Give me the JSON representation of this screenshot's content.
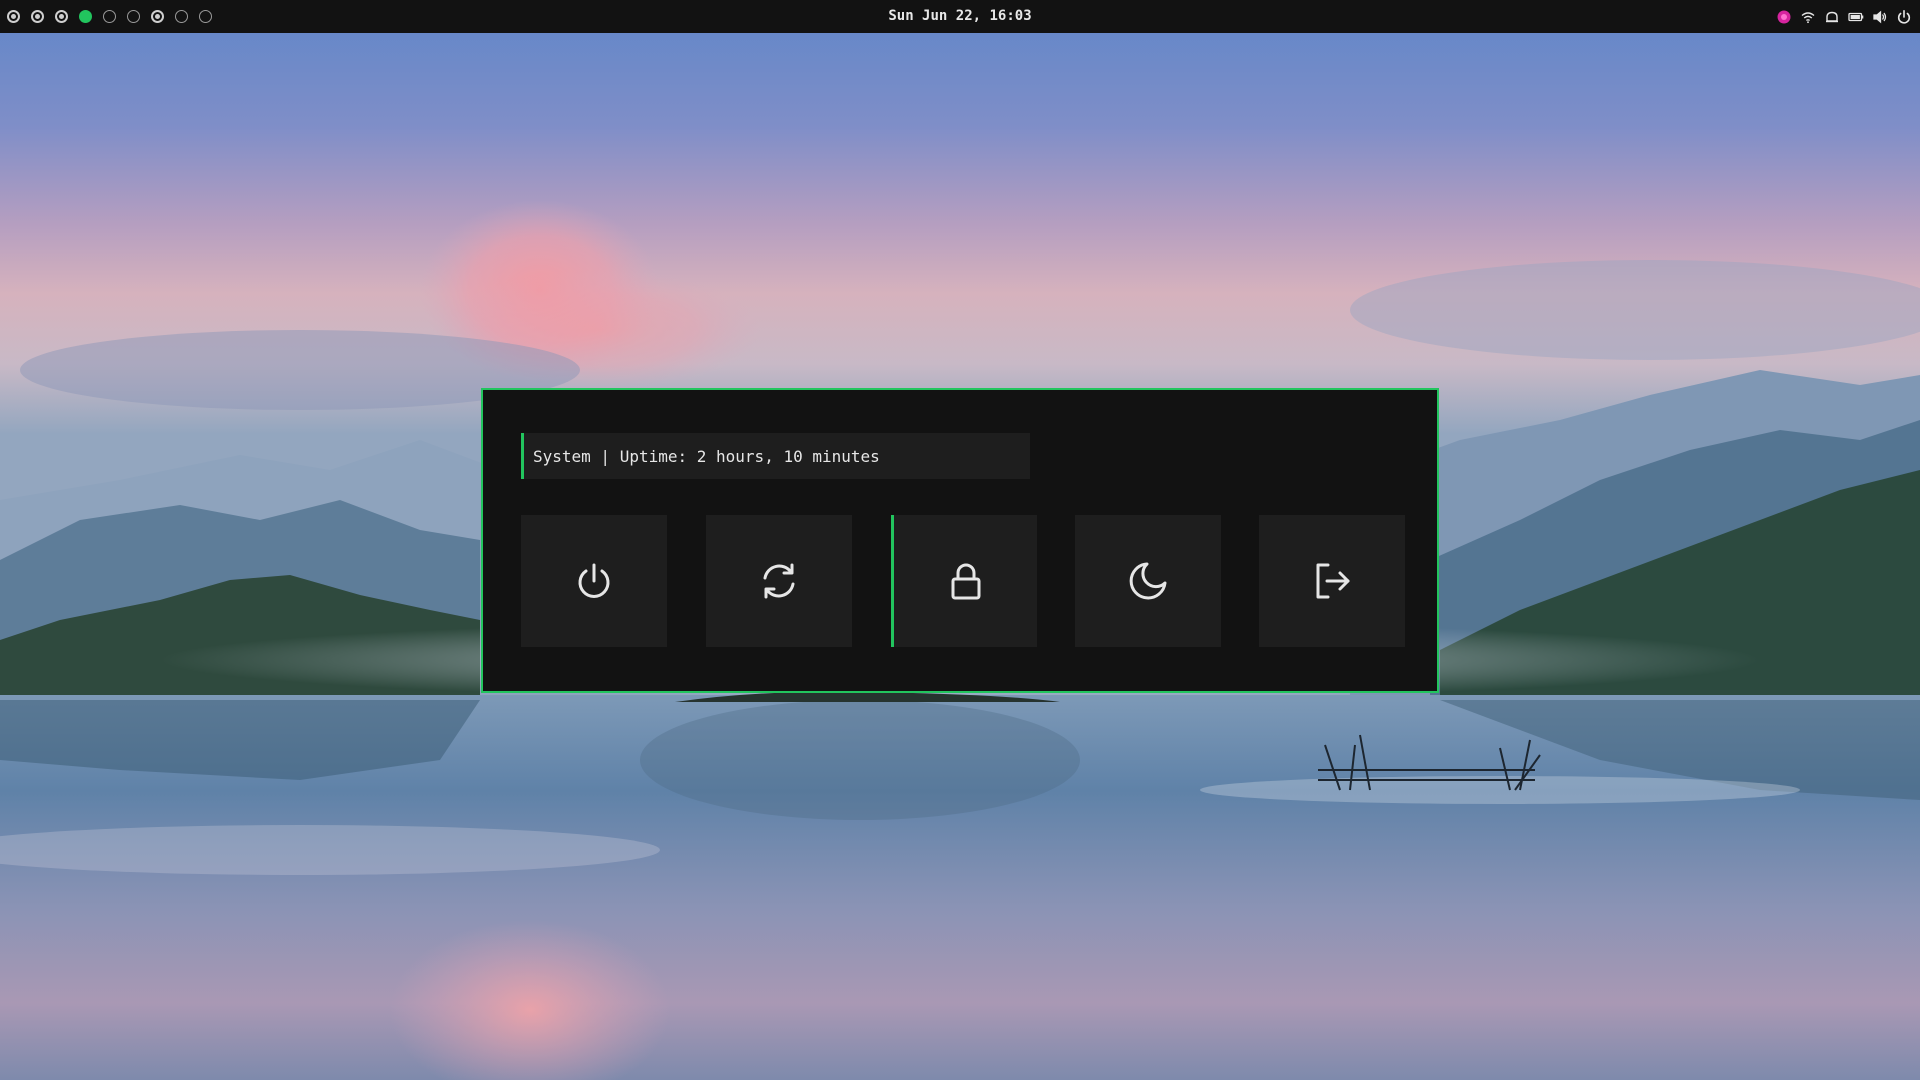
{
  "topbar": {
    "clock": "Sun Jun 22, 16:03",
    "workspaces": [
      {
        "state": "occupied"
      },
      {
        "state": "occupied"
      },
      {
        "state": "occupied"
      },
      {
        "state": "active"
      },
      {
        "state": "empty"
      },
      {
        "state": "empty"
      },
      {
        "state": "occupied"
      },
      {
        "state": "empty"
      },
      {
        "state": "empty"
      }
    ],
    "tray_icons": [
      "app-indicator-icon",
      "wifi-icon",
      "notification-icon",
      "battery-icon",
      "volume-icon",
      "power-icon"
    ]
  },
  "power_menu": {
    "prompt": "System | Uptime: 2 hours, 10 minutes",
    "actions": [
      {
        "name": "shutdown",
        "icon": "power-icon"
      },
      {
        "name": "reboot",
        "icon": "refresh-icon"
      },
      {
        "name": "lock",
        "icon": "lock-icon",
        "selected": true
      },
      {
        "name": "suspend",
        "icon": "moon-icon"
      },
      {
        "name": "logout",
        "icon": "logout-icon"
      }
    ]
  },
  "colors": {
    "accent": "#22c55e",
    "menu_bg": "#121212",
    "button_bg": "#1e1e1e",
    "bar_bg": "#121212",
    "text": "#e6e6e6"
  }
}
